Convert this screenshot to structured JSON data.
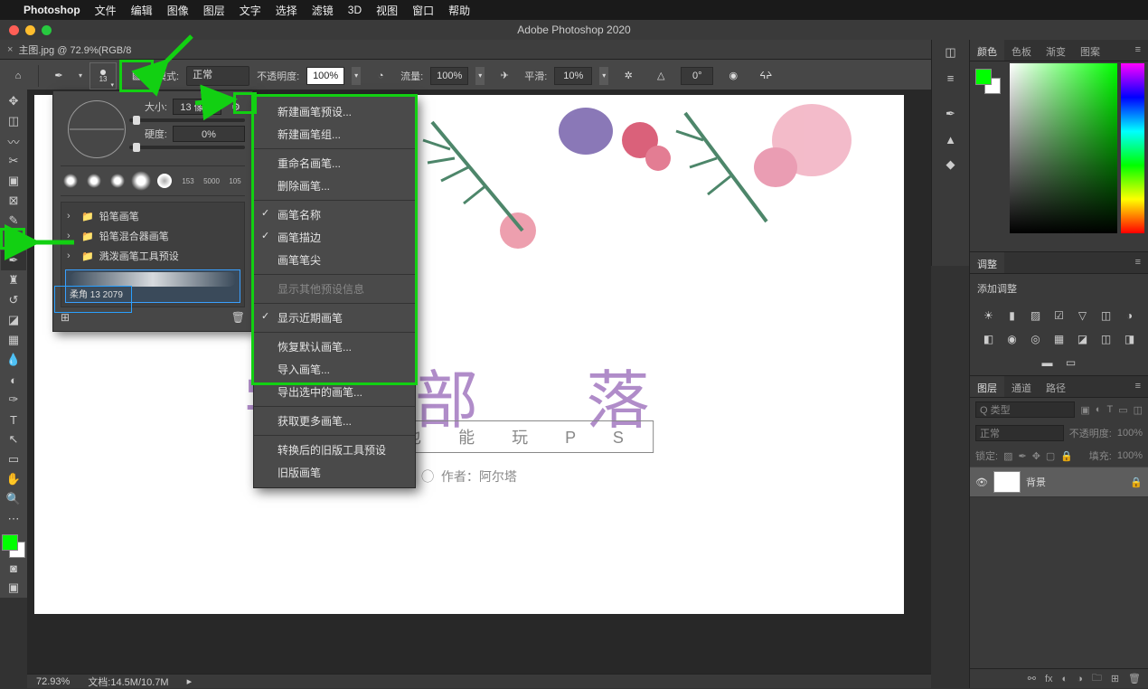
{
  "mac_menu": {
    "app": "Photoshop",
    "items": [
      "文件",
      "编辑",
      "图像",
      "图层",
      "文字",
      "选择",
      "滤镜",
      "3D",
      "视图",
      "窗口",
      "帮助"
    ]
  },
  "window_title": "Adobe Photoshop 2020",
  "doc_tab": {
    "close": "×",
    "label": "主图.jpg @ 72.9%(RGB/8"
  },
  "options": {
    "brush_size_text": "13",
    "mode_label": "模式:",
    "mode_value": "正常",
    "opacity_label": "不透明度:",
    "opacity_value": "100%",
    "flow_label": "流量:",
    "flow_value": "100%",
    "smooth_label": "平滑:",
    "smooth_value": "10%",
    "angle_value": "0°"
  },
  "brush_popup": {
    "size_label": "大小:",
    "size_value": "13 像素",
    "hardness_label": "硬度:",
    "hardness_value": "0%",
    "strip": [
      {
        "n": ""
      },
      {
        "n": ""
      },
      {
        "n": ""
      },
      {
        "n": ""
      },
      {
        "n": ""
      },
      {
        "n": "153"
      },
      {
        "n": "5000"
      },
      {
        "n": "105"
      }
    ],
    "folders": [
      "铅笔画笔",
      "铅笔混合器画笔",
      "溅泼画笔工具预设"
    ],
    "selected": "柔角 13 2079"
  },
  "ctx_menu": {
    "groups": [
      [
        {
          "t": "新建画笔预设...",
          "chk": false
        },
        {
          "t": "新建画笔组...",
          "chk": false
        }
      ],
      [
        {
          "t": "重命名画笔...",
          "chk": false
        },
        {
          "t": "删除画笔...",
          "chk": false
        }
      ],
      [
        {
          "t": "画笔名称",
          "chk": true
        },
        {
          "t": "画笔描边",
          "chk": true
        },
        {
          "t": "画笔笔尖",
          "chk": false
        }
      ],
      [
        {
          "t": "显示其他预设信息",
          "dis": true
        }
      ],
      [
        {
          "t": "显示近期画笔",
          "chk": true
        }
      ],
      [
        {
          "t": "恢复默认画笔...",
          "chk": false
        },
        {
          "t": "导入画笔...",
          "chk": false
        },
        {
          "t": "导出选中的画笔...",
          "chk": false
        }
      ],
      [
        {
          "t": "获取更多画笔...",
          "chk": false
        }
      ],
      [
        {
          "t": "转换后的旧版工具预设",
          "chk": false
        },
        {
          "t": "旧版画笔",
          "chk": false
        }
      ]
    ]
  },
  "right": {
    "color_tabs": [
      "颜色",
      "色板",
      "渐变",
      "图案"
    ],
    "adjust_tab": "调整",
    "adjust_label": "添加调整",
    "layers_tabs": [
      "图层",
      "通道",
      "路径"
    ],
    "layer_filter": "Q 类型",
    "blend": "正常",
    "blend_op_label": "不透明度:",
    "blend_op_value": "100%",
    "lock_label": "锁定:",
    "fill_label": "填充:",
    "fill_value": "100%",
    "layer_name": "背景"
  },
  "status": {
    "zoom": "72.93%",
    "doc": "文档:14.5M/10.7M"
  },
  "canvas": {
    "main_text": "学 部 落",
    "sub": "小 白 也 能 玩 P S",
    "author": "作者：阿尔塔"
  }
}
